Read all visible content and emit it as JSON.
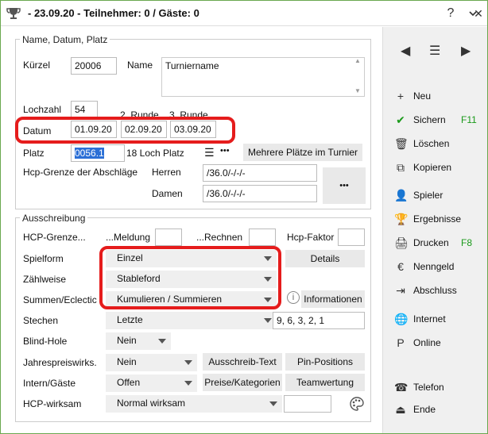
{
  "window": {
    "title": "- 23.09.20 - Teilnehmer: 0 / Gäste: 0",
    "help": "?",
    "collapse": "⌄",
    "close": "✕"
  },
  "group1": {
    "legend": "Name, Datum, Platz",
    "kuerzel_label": "Kürzel",
    "kuerzel_value": "20006",
    "name_label": "Name",
    "name_value": "Turniername",
    "lochzahl_label": "Lochzahl",
    "lochzahl_value": "54",
    "runde2_label": "2. Runde",
    "runde3_label": "3. Runde",
    "datum_label": "Datum",
    "datum1": "01.09.20",
    "datum2": "02.09.20",
    "datum3": "03.09.20",
    "platz_label": "Platz",
    "platz_value": "0056.1",
    "platz_desc": "18 Loch Platz",
    "mehrere_button": "Mehrere Plätze im Turnier",
    "hcp_grenze_label": "Hcp-Grenze der Abschläge",
    "herren_label": "Herren",
    "herren_value": "/36.0/-/-/-",
    "damen_label": "Damen",
    "damen_value": "/36.0/-/-/-",
    "more_button": "•••"
  },
  "group2": {
    "legend": "Ausschreibung",
    "hcp_grenze_label": "HCP-Grenze...",
    "meldung_label": "...Meldung",
    "meldung_value": "",
    "rechnen_label": "...Rechnen",
    "rechnen_value": "",
    "hcp_faktor_label": "Hcp-Faktor",
    "hcp_faktor_value": "",
    "spielform_label": "Spielform",
    "spielform_value": "Einzel",
    "details_button": "Details",
    "zaehlweise_label": "Zählweise",
    "zaehlweise_value": "Stableford",
    "summen_label": "Summen/Eclectic",
    "summen_value": "Kumulieren / Summieren",
    "informationen_button": "Informationen",
    "stechen_label": "Stechen",
    "stechen_value": "Letzte",
    "stechen_holes": "9, 6, 3, 2, 1",
    "blind_label": "Blind-Hole",
    "blind_value": "Nein",
    "jahres_label": "Jahrespreiswirks.",
    "jahres_value": "Nein",
    "ausschreib_button": "Ausschreib-Text",
    "pin_button": "Pin-Positions",
    "intern_label": "Intern/Gäste",
    "intern_value": "Offen",
    "preise_button": "Preise/Kategorien",
    "team_button": "Teamwertung",
    "hcpw_label": "HCP-wirksam",
    "hcpw_value": "Normal wirksam",
    "hcpw_extra": ""
  },
  "sidebar": {
    "actions": [
      {
        "label": "Neu",
        "shortcut": "",
        "icon": "+"
      },
      {
        "label": "Sichern",
        "shortcut": "F11",
        "icon": "✔"
      },
      {
        "label": "Löschen",
        "shortcut": "",
        "icon": "🗑"
      },
      {
        "label": "Kopieren",
        "shortcut": "",
        "icon": "⧉"
      },
      {
        "label": "Spieler",
        "shortcut": "",
        "icon": "👤"
      },
      {
        "label": "Ergebnisse",
        "shortcut": "",
        "icon": "🏆"
      },
      {
        "label": "Drucken",
        "shortcut": "F8",
        "icon": "🖨"
      },
      {
        "label": "Nenngeld",
        "shortcut": "",
        "icon": "€"
      },
      {
        "label": "Abschluss",
        "shortcut": "",
        "icon": "⇥"
      },
      {
        "label": "Internet",
        "shortcut": "",
        "icon": "🌐"
      },
      {
        "label": "Online",
        "shortcut": "",
        "icon": "P"
      },
      {
        "label": "Telefon",
        "shortcut": "",
        "icon": "☎"
      },
      {
        "label": "Ende",
        "shortcut": "",
        "icon": "⏏"
      }
    ],
    "nav_prev": "◀",
    "nav_menu": "☰",
    "nav_next": "▶"
  },
  "colors": {
    "highlight": "#e51c1c",
    "accent_green": "#1a9a1a"
  }
}
